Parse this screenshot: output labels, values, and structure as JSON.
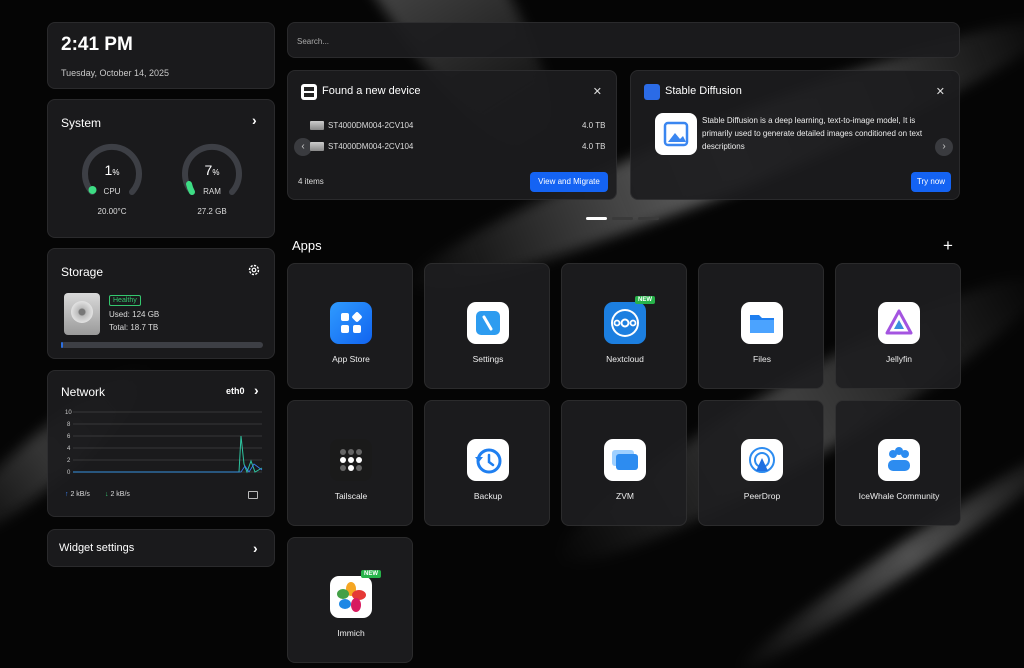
{
  "clock": {
    "time": "2:41 PM",
    "date": "Tuesday, October 14, 2025"
  },
  "system": {
    "title": "System",
    "cpu": {
      "value": "1",
      "unit": "%",
      "label": "CPU",
      "sub": "20.00°C",
      "percent": 1
    },
    "ram": {
      "value": "7",
      "unit": "%",
      "label": "RAM",
      "sub": "27.2 GB",
      "percent": 7
    }
  },
  "storage": {
    "title": "Storage",
    "status": "Healthy",
    "used": "Used: 124 GB",
    "total": "Total: 18.7 TB",
    "fill_fraction": 0.007
  },
  "network": {
    "title": "Network",
    "interface": "eth0",
    "y_ticks": [
      "10",
      "8",
      "6",
      "4",
      "2",
      "0"
    ],
    "upload": "2 kB/s",
    "download": "2 kB/s"
  },
  "widget_settings": {
    "label": "Widget settings"
  },
  "search": {
    "placeholder": "Search..."
  },
  "device_card": {
    "title": "Found a new device",
    "devices": [
      {
        "name": "ST4000DM004-2CV104",
        "size": "4.0 TB"
      },
      {
        "name": "ST4000DM004-2CV104",
        "size": "4.0 TB"
      }
    ],
    "items": "4 items",
    "action": "View and Migrate"
  },
  "sd_card": {
    "title": "Stable Diffusion",
    "description": "Stable Diffusion is a deep learning, text-to-image model, It is primarily used to generate detailed images conditioned on text descriptions",
    "action": "Try now"
  },
  "apps": {
    "title": "Apps",
    "add": "+",
    "list": [
      {
        "name": "App Store",
        "icon": "app-store-icon",
        "new": false
      },
      {
        "name": "Settings",
        "icon": "settings-icon",
        "new": false
      },
      {
        "name": "Nextcloud",
        "icon": "nextcloud-icon",
        "new": true
      },
      {
        "name": "Files",
        "icon": "files-icon",
        "new": false
      },
      {
        "name": "Jellyfin",
        "icon": "jellyfin-icon",
        "new": false
      },
      {
        "name": "Tailscale",
        "icon": "tailscale-icon",
        "new": false
      },
      {
        "name": "Backup",
        "icon": "backup-icon",
        "new": false
      },
      {
        "name": "ZVM",
        "icon": "zvm-icon",
        "new": false
      },
      {
        "name": "PeerDrop",
        "icon": "peerdrop-icon",
        "new": false
      },
      {
        "name": "IceWhale Community",
        "icon": "icewhale-community-icon",
        "new": false
      },
      {
        "name": "Immich",
        "icon": "immich-icon",
        "new": true
      }
    ],
    "new_label": "NEW"
  },
  "colors": {
    "accent": "#1463f3",
    "healthy": "#35c76f",
    "gauge_green": "#3ddc84",
    "chart_teal": "#2ec4a0"
  }
}
